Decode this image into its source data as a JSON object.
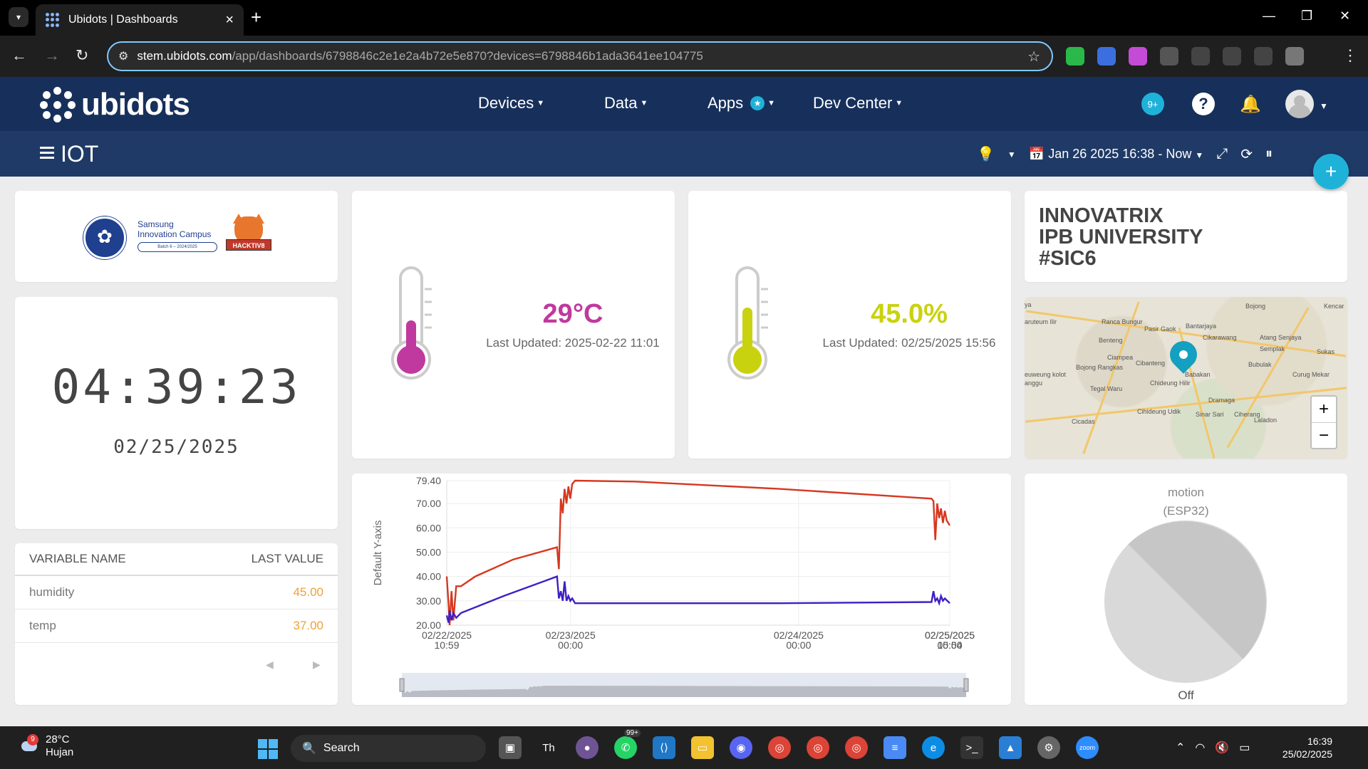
{
  "browser": {
    "tab_title": "Ubidots | Dashboards",
    "url_host": "stem.ubidots.com",
    "url_path": "/app/dashboards/6798846c2e1e2a4b72e5e870?devices=6798846b1ada3641ee104775",
    "extensions": [
      {
        "icon": "green-puzzle-icon",
        "color": "#2bb84a"
      },
      {
        "icon": "shield-icon",
        "color": "#3b6fe0"
      },
      {
        "icon": "brain-icon",
        "color": "#c44bd6"
      },
      {
        "icon": "camera-icon",
        "color": "#555555"
      },
      {
        "icon": "extensions-icon",
        "color": "#444444"
      },
      {
        "icon": "media-icon",
        "color": "#444444"
      },
      {
        "icon": "download-icon",
        "color": "#444444"
      },
      {
        "icon": "profile-icon",
        "color": "#777777"
      }
    ]
  },
  "header": {
    "logo_text": "ubidots",
    "nav": [
      {
        "label": "Devices"
      },
      {
        "label": "Data"
      },
      {
        "label": "Apps"
      },
      {
        "label": "Dev Center"
      }
    ],
    "notifications_badge": "9+"
  },
  "dashboard": {
    "title": "IOT",
    "date_range": "Jan 26 2025 16:38 - Now"
  },
  "logos": {
    "samsung_line1": "Samsung",
    "samsung_line2": "Innovation Campus",
    "samsung_pill": "Batch 6 – 2024/2025",
    "hacktiv": "HACKTIV8"
  },
  "clock": {
    "time": "04:39:23",
    "date": "02/25/2025"
  },
  "variables_table": {
    "col_name": "VARIABLE NAME",
    "col_value": "LAST VALUE",
    "rows": [
      {
        "name": "humidity",
        "value": "45.00"
      },
      {
        "name": "temp",
        "value": "37.00"
      }
    ]
  },
  "temperature": {
    "value": "29°C",
    "updated": "Last Updated: 2025-02-22 11:01",
    "color": "#c0399f",
    "fill_level": 0.29
  },
  "humidity": {
    "value": "45.0%",
    "updated": "Last Updated: 02/25/2025 15:56",
    "color": "#c9d20f",
    "fill_level": 0.45
  },
  "title_widget": {
    "line1": "INNOVATRIX",
    "line2": "IPB UNIVERSITY",
    "line3": "#SIC6"
  },
  "map": {
    "labels": [
      "Bojong",
      "Kencar",
      "Ranca Bungur",
      "Pasir Gaok",
      "Bantarjaya",
      "Cikarawang",
      "Atang Senjaya",
      "Benteng",
      "Semplak",
      "Sukas",
      "Ciampea",
      "Cibanteng",
      "Bubulak",
      "Curug Mekar",
      "Bojong Rangkas",
      "Babakan",
      "Chideung Hilir",
      "Tegal Waru",
      "Dramaga",
      "Cihideung Udik",
      "Sinar Sari",
      "Ciherang",
      "Cicadas",
      "Laladon",
      "euweung kolot",
      "anggu",
      "aruteum Ilir",
      "ya"
    ],
    "zoom_in": "+",
    "zoom_out": "−"
  },
  "chart_data": {
    "type": "line",
    "ylabel": "Default Y-axis",
    "yticks": [
      "79.40",
      "70.00",
      "60.00",
      "50.00",
      "40.00",
      "30.00",
      "20.00"
    ],
    "ylim": [
      20,
      79.4
    ],
    "xticks": [
      {
        "l1": "02/22/2025",
        "l2": "10:59"
      },
      {
        "l1": "02/23/2025",
        "l2": "00:00"
      },
      {
        "l1": "02/24/2025",
        "l2": "00:00"
      },
      {
        "l1": "02/25/2025",
        "l2": "00:00"
      },
      {
        "l1": "02/25/2025",
        "l2": "15:54"
      }
    ],
    "xlim": [
      0,
      52.92
    ],
    "x_unit": "hours since 02/22/2025 10:59",
    "series": [
      {
        "color": "#d6371f",
        "points": [
          [
            0,
            40
          ],
          [
            0.2,
            28
          ],
          [
            0.3,
            20
          ],
          [
            0.5,
            34
          ],
          [
            0.7,
            22
          ],
          [
            1.0,
            36
          ],
          [
            1.5,
            36
          ],
          [
            3,
            40
          ],
          [
            7,
            47
          ],
          [
            11.6,
            52
          ],
          [
            11.8,
            43
          ],
          [
            12,
            72
          ],
          [
            12.2,
            66
          ],
          [
            12.4,
            76
          ],
          [
            12.6,
            70
          ],
          [
            12.8,
            77
          ],
          [
            13,
            72
          ],
          [
            13.2,
            78
          ],
          [
            13.5,
            79.4
          ],
          [
            20,
            79
          ],
          [
            35,
            76
          ],
          [
            51,
            72
          ],
          [
            51.2,
            71
          ],
          [
            51.4,
            55
          ],
          [
            51.6,
            70
          ],
          [
            51.8,
            64
          ],
          [
            52,
            68
          ],
          [
            52.2,
            62
          ],
          [
            52.4,
            67
          ],
          [
            52.6,
            63
          ],
          [
            52.92,
            61
          ]
        ]
      },
      {
        "color": "#3f1ec4",
        "points": [
          [
            0,
            24
          ],
          [
            0.2,
            21
          ],
          [
            0.3,
            26
          ],
          [
            0.5,
            22
          ],
          [
            0.7,
            25
          ],
          [
            1.0,
            23
          ],
          [
            1.5,
            25
          ],
          [
            6,
            32
          ],
          [
            11.6,
            40
          ],
          [
            11.8,
            31
          ],
          [
            12,
            34
          ],
          [
            12.2,
            30
          ],
          [
            12.4,
            38
          ],
          [
            12.6,
            30
          ],
          [
            12.8,
            32
          ],
          [
            13,
            30
          ],
          [
            13.2,
            31
          ],
          [
            13.5,
            29
          ],
          [
            20,
            29
          ],
          [
            35,
            29
          ],
          [
            51,
            29.5
          ],
          [
            51.2,
            34
          ],
          [
            51.4,
            30
          ],
          [
            51.6,
            31
          ],
          [
            51.8,
            29
          ],
          [
            52,
            32
          ],
          [
            52.2,
            30
          ],
          [
            52.4,
            31
          ],
          [
            52.92,
            29
          ]
        ]
      }
    ]
  },
  "pie": {
    "title_line1": "motion",
    "title_line2": "(ESP32)",
    "state": "Off",
    "colors": [
      "#d9d9d9",
      "#c6c6c6"
    ]
  },
  "taskbar": {
    "temp": "28°C",
    "condition": "Hujan",
    "weather_badge": "9",
    "search_label": "Search",
    "whatsapp_count": "99+",
    "time": "16:39",
    "date": "25/02/2025"
  }
}
